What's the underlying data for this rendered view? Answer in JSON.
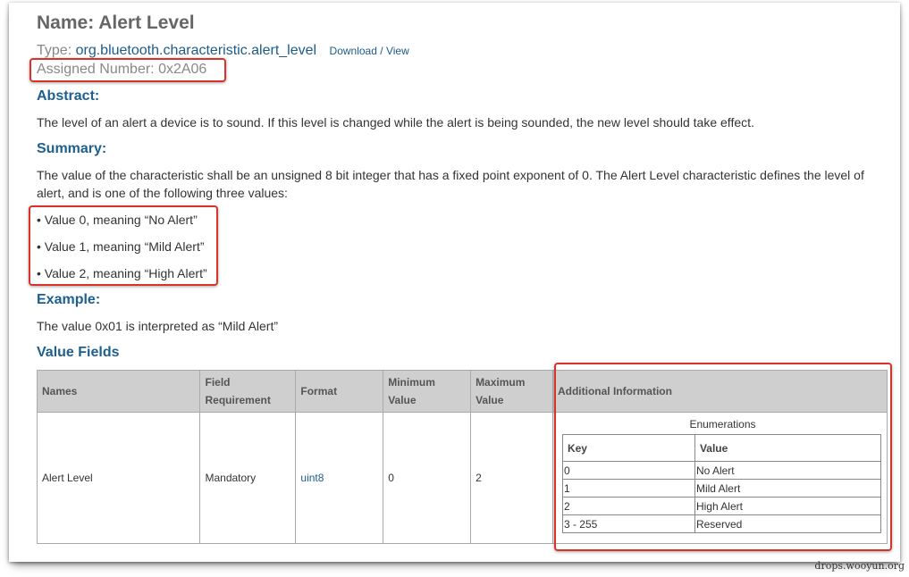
{
  "header": {
    "title": "Name: Alert Level",
    "type_label": "Type:",
    "type_link": "org.bluetooth.characteristic.alert_level",
    "download_link": "Download",
    "slash": "/",
    "view_link": "View",
    "assigned_number": "Assigned Number: 0x2A06"
  },
  "abstract": {
    "heading": "Abstract:",
    "text": "The level of an alert a device is to sound. If this level is changed while the alert is being sounded, the new level should take effect."
  },
  "summary": {
    "heading": "Summary:",
    "text": "The value of the characteristic shall be an unsigned 8 bit integer that has a fixed point exponent of 0. The Alert Level characteristic defines the level of alert, and is one of the following three values:",
    "items": [
      "• Value 0, meaning “No Alert”",
      "• Value 1, meaning “Mild Alert”",
      "• Value 2, meaning “High Alert”"
    ]
  },
  "example": {
    "heading": "Example:",
    "text": "The value 0x01 is interpreted as “Mild Alert”"
  },
  "value_fields": {
    "heading": "Value Fields",
    "columns": {
      "names": "Names",
      "field_req_1": "Field",
      "field_req_2": "Requirement",
      "format": "Format",
      "min_1": "Minimum",
      "min_2": "Value",
      "max_1": "Maximum",
      "max_2": "Value",
      "additional": "Additional Information"
    },
    "row": {
      "name": "Alert Level",
      "requirement": "Mandatory",
      "format": "uint8",
      "min": "0",
      "max": "2"
    },
    "enumerations": {
      "caption": "Enumerations",
      "key_header": "Key",
      "value_header": "Value",
      "rows": [
        {
          "key": "0",
          "value": "No Alert"
        },
        {
          "key": "1",
          "value": "Mild Alert"
        },
        {
          "key": "2",
          "value": "High Alert"
        },
        {
          "key": "3 - 255",
          "value": "Reserved"
        }
      ]
    }
  },
  "watermark": "drops.wooyun.org",
  "colors": {
    "heading_blue": "#1d5f8f",
    "link_blue": "#1c5c8c",
    "highlight_red": "#d9322a",
    "table_header_gray": "#cfcfcf"
  }
}
